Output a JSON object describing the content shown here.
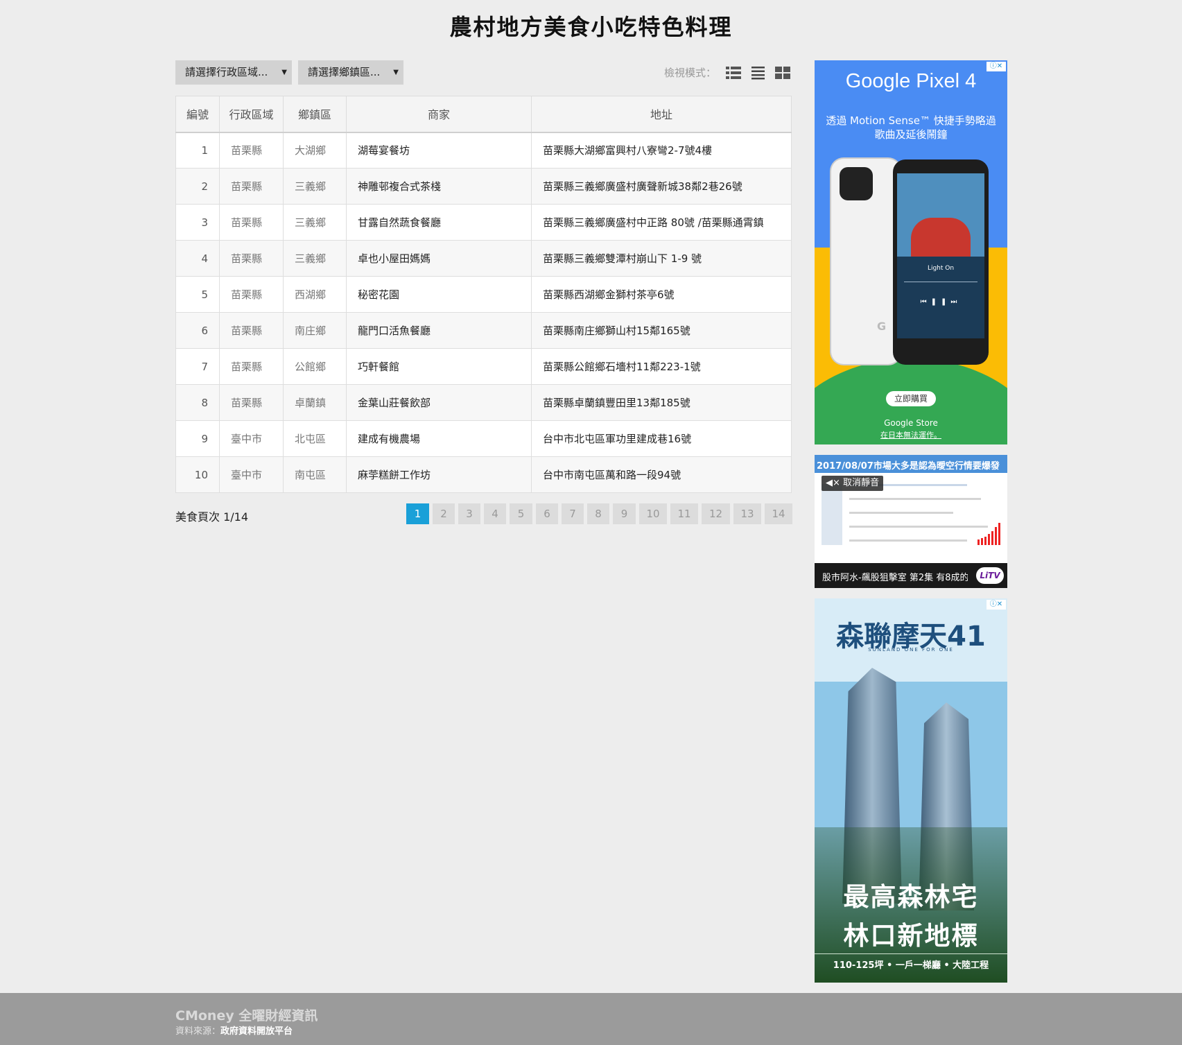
{
  "page": {
    "title": "農村地方美食小吃特色料理"
  },
  "filters": {
    "region_label": "請選擇行政區域...",
    "town_label": "請選擇鄉鎮區..."
  },
  "view_mode": {
    "label": "檢視模式：",
    "icons": [
      "table-view-icon",
      "list-view-icon",
      "grid-view-icon"
    ]
  },
  "table": {
    "headers": [
      "編號",
      "行政區域",
      "鄉鎮區",
      "商家",
      "地址"
    ],
    "rows": [
      {
        "no": "1",
        "region": "苗栗縣",
        "town": "大湖鄉",
        "shop": "湖莓宴餐坊",
        "address": "苗栗縣大湖鄉富興村八寮彎2-7號4樓"
      },
      {
        "no": "2",
        "region": "苗栗縣",
        "town": "三義鄉",
        "shop": "神雕邨複合式茶棧",
        "address": "苗栗縣三義鄉廣盛村廣聲新城38鄰2巷26號"
      },
      {
        "no": "3",
        "region": "苗栗縣",
        "town": "三義鄉",
        "shop": "甘露自然蔬食餐廳",
        "address": "苗栗縣三義鄉廣盛村中正路 80號 /苗栗縣通霄鎮"
      },
      {
        "no": "4",
        "region": "苗栗縣",
        "town": "三義鄉",
        "shop": "卓也小屋田媽媽",
        "address": "苗栗縣三義鄉雙潭村崩山下 1-9 號"
      },
      {
        "no": "5",
        "region": "苗栗縣",
        "town": "西湖鄉",
        "shop": "秘密花園",
        "address": "苗栗縣西湖鄉金獅村茶亭6號"
      },
      {
        "no": "6",
        "region": "苗栗縣",
        "town": "南庄鄉",
        "shop": "龍門口活魚餐廳",
        "address": "苗栗縣南庄鄉獅山村15鄰165號"
      },
      {
        "no": "7",
        "region": "苗栗縣",
        "town": "公館鄉",
        "shop": "巧軒餐館",
        "address": "苗栗縣公館鄉石墻村11鄰223-1號"
      },
      {
        "no": "8",
        "region": "苗栗縣",
        "town": "卓蘭鎮",
        "shop": "金葉山莊餐飲部",
        "address": "苗栗縣卓蘭鎮豐田里13鄰185號"
      },
      {
        "no": "9",
        "region": "臺中市",
        "town": "北屯區",
        "shop": "建成有機農場",
        "address": "台中市北屯區軍功里建成巷16號"
      },
      {
        "no": "10",
        "region": "臺中市",
        "town": "南屯區",
        "shop": "麻荢糕餅工作坊",
        "address": "台中市南屯區萬和路一段94號"
      }
    ]
  },
  "pagination": {
    "info": "美食頁次 1/14",
    "pages": [
      "1",
      "2",
      "3",
      "4",
      "5",
      "6",
      "7",
      "8",
      "9",
      "10",
      "11",
      "12",
      "13",
      "14"
    ],
    "current": "1"
  },
  "ads": {
    "pixel": {
      "title": "Google Pixel 4",
      "subtitle_line1": "透過 Motion Sense™ 快捷手勢略過",
      "subtitle_line2": "歌曲及延後鬧鐘",
      "song": "Light On",
      "cta": "立即購買",
      "store": "Google Store",
      "note": "在日本無法運作。"
    },
    "video": {
      "headline": "2017/08/07市場大多是認為曖空行情要爆發",
      "mute": "取消靜音",
      "caption": "股市阿水-飆股狙擊室 第2集 有8成的...",
      "logo": "LiTV"
    },
    "estate": {
      "brand": "森聯摩天41",
      "brand_en": "SUNLAND ONE FOR ONE",
      "line1": "最高森林宅",
      "line2": "林口新地標",
      "detail": "110-125坪 • 一戶一梯廳 • 大陸工程"
    }
  },
  "footer": {
    "brand": "CMoney 全曜財經資訊",
    "source_label": "資料來源：",
    "source_value": "政府資料開放平台"
  },
  "colors": {
    "accent": "#1aa0d8",
    "background": "#ededed",
    "footer": "#9b9b9b"
  }
}
